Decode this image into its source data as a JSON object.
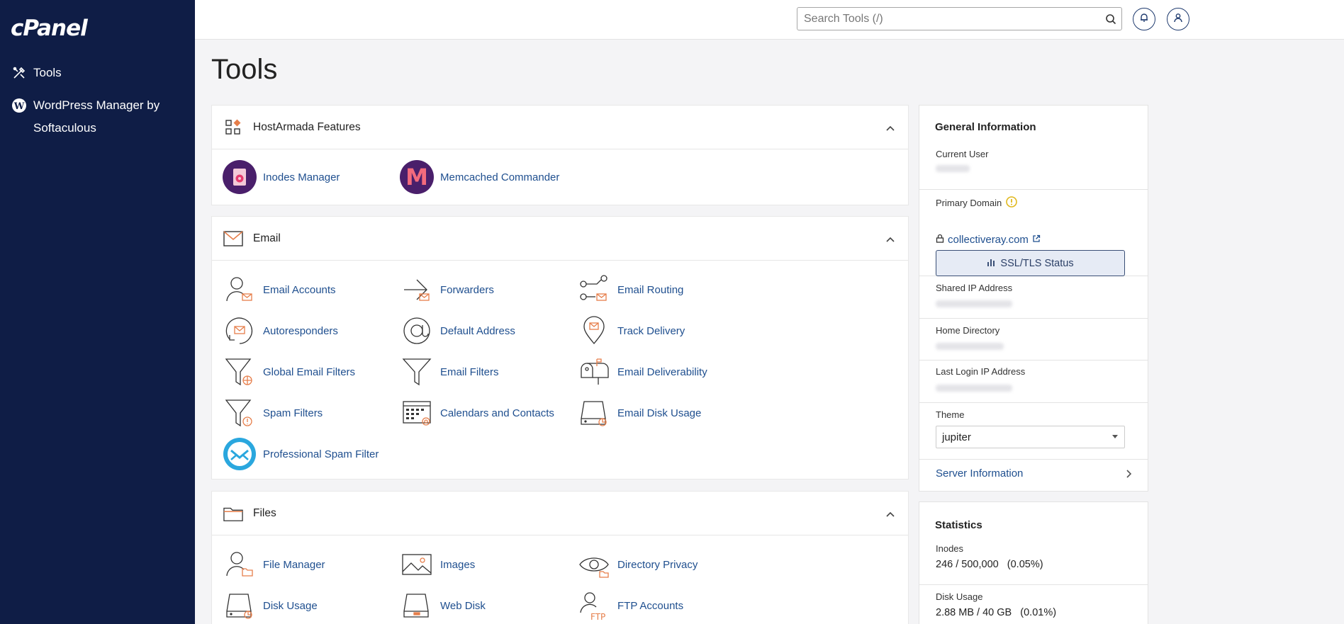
{
  "sidebar": {
    "logo": "cPanel",
    "items": [
      {
        "label": "Tools"
      },
      {
        "label": "WordPress Manager by Softaculous"
      }
    ]
  },
  "header": {
    "search_placeholder": "Search Tools (/)"
  },
  "page": {
    "title": "Tools"
  },
  "sections": {
    "hostarmada": {
      "title": "HostArmada Features",
      "tools": [
        "Inodes Manager",
        "Memcached Commander"
      ]
    },
    "email": {
      "title": "Email",
      "tools": [
        "Email Accounts",
        "Forwarders",
        "Email Routing",
        "Autoresponders",
        "Default Address",
        "Track Delivery",
        "Global Email Filters",
        "Email Filters",
        "Email Deliverability",
        "Spam Filters",
        "Calendars and Contacts",
        "Email Disk Usage",
        "Professional Spam Filter"
      ]
    },
    "files": {
      "title": "Files",
      "tools": [
        "File Manager",
        "Images",
        "Directory Privacy",
        "Disk Usage",
        "Web Disk",
        "FTP Accounts"
      ]
    }
  },
  "general_info": {
    "title": "General Information",
    "current_user_label": "Current User",
    "primary_domain_label": "Primary Domain",
    "primary_domain": "collectiveray.com",
    "ssl_button": "SSL/TLS Status",
    "shared_ip_label": "Shared IP Address",
    "home_dir_label": "Home Directory",
    "last_login_label": "Last Login IP Address",
    "theme_label": "Theme",
    "theme_value": "jupiter",
    "server_info": "Server Information"
  },
  "statistics": {
    "title": "Statistics",
    "inodes_label": "Inodes",
    "inodes_value": "246 / 500,000   (0.05%)",
    "disk_label": "Disk Usage",
    "disk_value": "2.88 MB / 40 GB   (0.01%)"
  },
  "colors": {
    "sidebar": "#0f1d46",
    "link": "#1f4f8f",
    "accent": "#e67e4a"
  }
}
